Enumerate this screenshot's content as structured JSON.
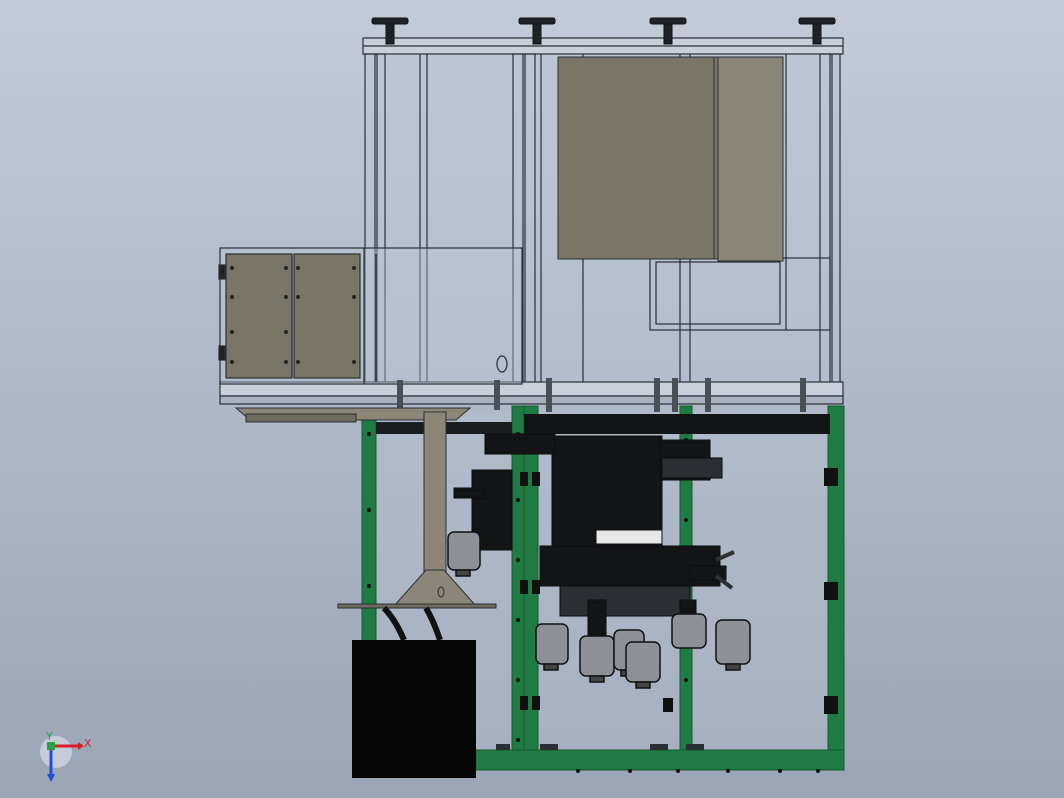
{
  "viewport": {
    "background_top": "#c3cbd7",
    "background_bottom": "#9aa5b6"
  },
  "colors": {
    "frame_line": "#2a2f36",
    "glass_fill": "#b9c4d2",
    "panel_fill": "#7a7666",
    "panel_fill_light": "#8a8676",
    "green_frame": "#1f7a44",
    "green_frame_dark": "#145a31",
    "mechanism": "#121416",
    "mechanism_grey": "#2b2f33",
    "cylinder": "#8d9096",
    "stand_fill": "#8b8677",
    "base_block": "#050505",
    "axis_x": "#d61f26",
    "axis_y": "#2ea043",
    "axis_z": "#1f4fd6"
  },
  "triad": {
    "x_label": "X",
    "y_label": "Y"
  }
}
